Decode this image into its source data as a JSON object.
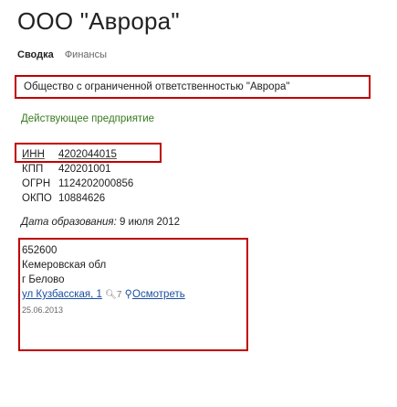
{
  "header": {
    "title": "ООО \"Аврора\"",
    "tabs": [
      "Сводка",
      "Финансы"
    ]
  },
  "company": {
    "full_name": "Общество с ограниченной ответственностью \"Аврора\"",
    "status": "Действующее предприятие",
    "founded_label": "Дата образования:",
    "founded_value": "9 июля 2012"
  },
  "requisites": [
    {
      "label": "ИНН",
      "value": "4202044015"
    },
    {
      "label": "КПП",
      "value": "420201001"
    },
    {
      "label": "ОГРН",
      "value": "1124202000856"
    },
    {
      "label": "ОКПО",
      "value": "10884626"
    }
  ],
  "address": {
    "postcode": "652600",
    "region": "Кемеровская обл",
    "city": "г Белово",
    "street": "ул Кузбасская, 1",
    "count": "7",
    "map_link": "Осмотреть",
    "date": "25.06.2013"
  }
}
